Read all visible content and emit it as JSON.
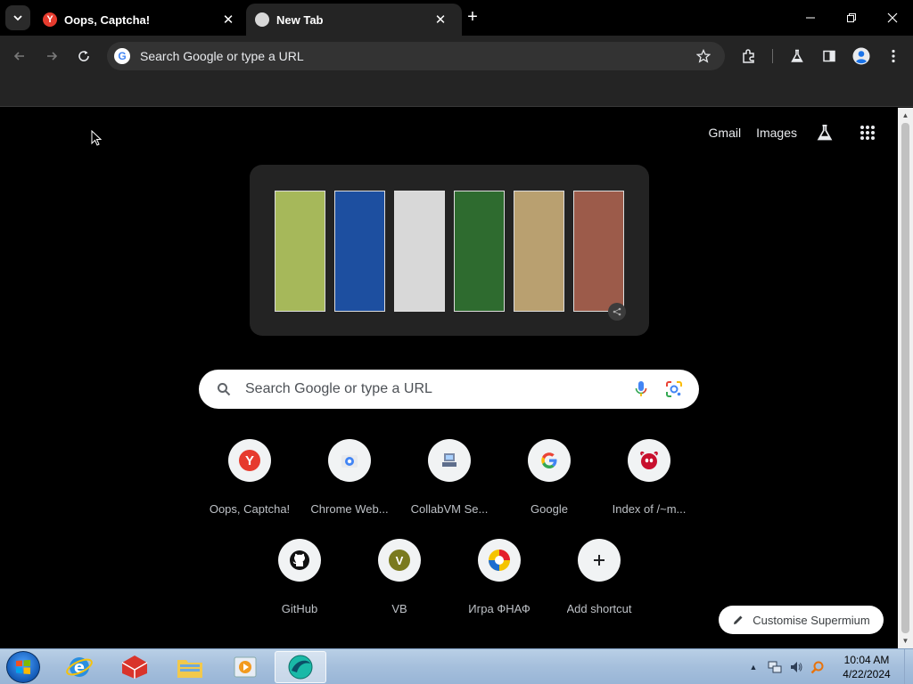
{
  "tabs": [
    {
      "title": "Oops, Captcha!",
      "favicon": "yandex-icon",
      "active": false
    },
    {
      "title": "New Tab",
      "favicon": "chrome-newtab-icon",
      "active": true
    }
  ],
  "toolbar": {
    "omnibox_placeholder": "Search Google or type a URL"
  },
  "page": {
    "toplinks": [
      "Gmail",
      "Images"
    ],
    "search_placeholder": "Search Google or type a URL",
    "doodle_panel_colors": [
      "#a6b85a",
      "#1d4fa0",
      "#d8d8d8",
      "#2e6b2f",
      "#b9a070",
      "#9c5b4a"
    ],
    "shortcuts_row1": [
      {
        "label": "Oops, Captcha!",
        "icon": "yandex-icon"
      },
      {
        "label": "Chrome Web...",
        "icon": "chrome-webstore-icon"
      },
      {
        "label": "CollabVM Se...",
        "icon": "collabvm-icon"
      },
      {
        "label": "Google",
        "icon": "google-g-icon"
      },
      {
        "label": "Index of /~m...",
        "icon": "freebsd-icon"
      }
    ],
    "shortcuts_row2": [
      {
        "label": "GitHub",
        "icon": "github-icon"
      },
      {
        "label": "VB",
        "icon": "letter-v-icon",
        "letter": "V"
      },
      {
        "label": "Игра ФНАФ",
        "icon": "fnaf-icon"
      },
      {
        "label": "Add shortcut",
        "icon": "plus-icon"
      }
    ],
    "customise_label": "Customise Supermium"
  },
  "taskbar": {
    "time": "10:04 AM",
    "date": "4/22/2024",
    "apps": [
      "internet-explorer-icon",
      "app-red-icon",
      "file-explorer-icon",
      "media-player-icon",
      "supermium-icon"
    ]
  },
  "colors": {
    "accent_red": "#e63b2e",
    "page_bg": "#000000",
    "toolbar_bg": "#242424"
  }
}
